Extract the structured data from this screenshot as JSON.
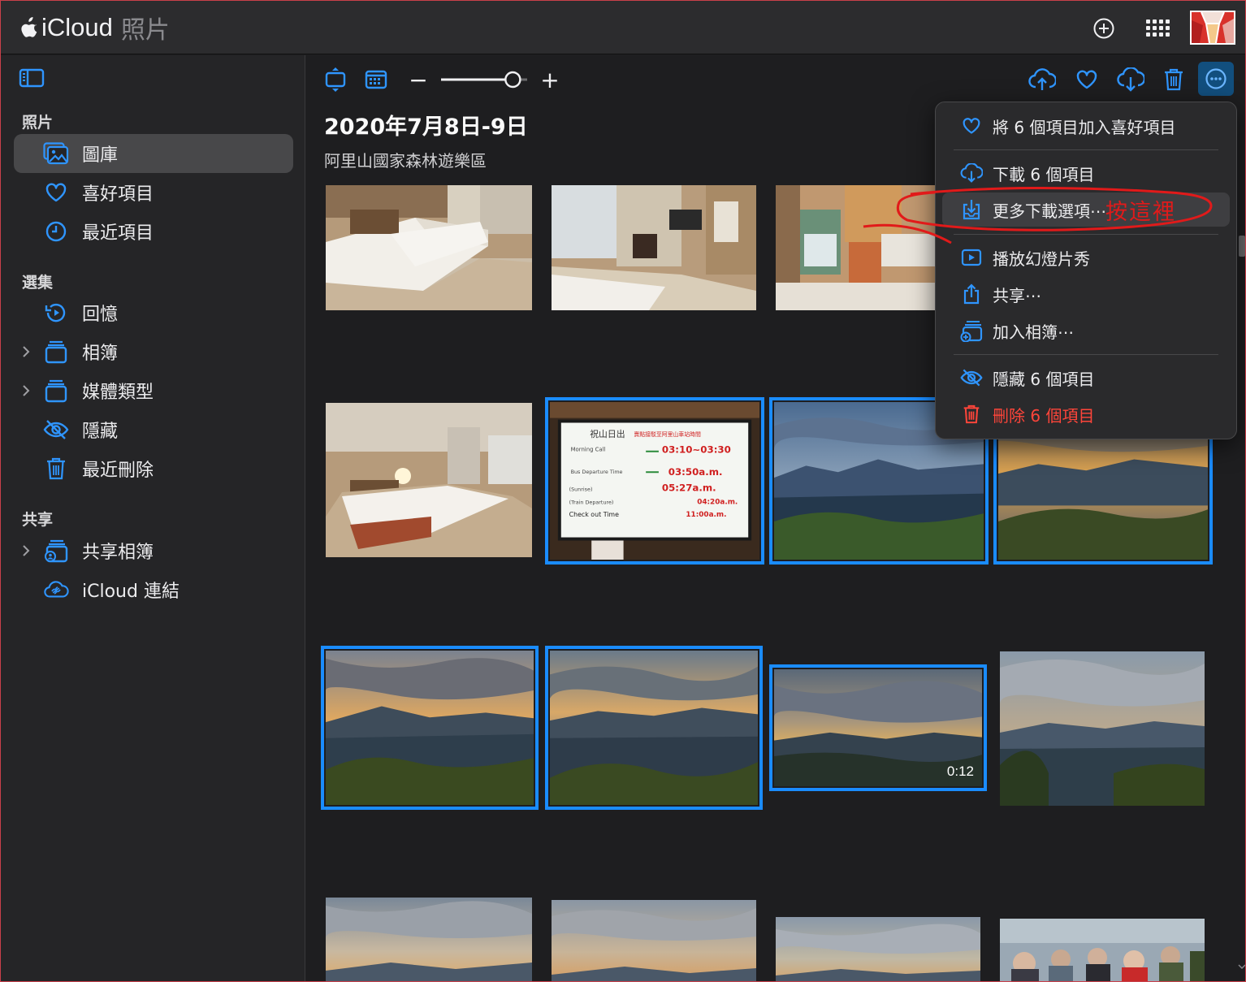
{
  "app": {
    "brand": "iCloud",
    "product": "照片"
  },
  "sidebar": {
    "sections": [
      {
        "title": "照片"
      },
      {
        "title": "選集"
      },
      {
        "title": "共享"
      }
    ],
    "items": [
      {
        "label": "圖庫",
        "icon": "photo-library-icon",
        "active": true
      },
      {
        "label": "喜好項目",
        "icon": "heart-icon"
      },
      {
        "label": "最近項目",
        "icon": "clock-icon"
      },
      {
        "label": "回憶",
        "icon": "memories-icon"
      },
      {
        "label": "相簿",
        "icon": "album-stack-icon",
        "expandable": true
      },
      {
        "label": "媒體類型",
        "icon": "album-stack-icon",
        "expandable": true
      },
      {
        "label": "隱藏",
        "icon": "eye-slash-icon"
      },
      {
        "label": "最近刪除",
        "icon": "trash-icon"
      },
      {
        "label": "共享相簿",
        "icon": "shared-album-icon",
        "expandable": true
      },
      {
        "label": "iCloud 連結",
        "icon": "link-cloud-icon"
      }
    ]
  },
  "toolbar": {
    "zoom_minus": "−",
    "zoom_plus": "+",
    "zoom_level": 0.82
  },
  "content": {
    "date_title": "2020年7月8日-9日",
    "location": "阿里山國家森林遊樂區",
    "video_duration": "0:12"
  },
  "menu": {
    "items": [
      {
        "label": "將 6 個項目加入喜好項目",
        "icon": "heart-icon"
      },
      {
        "label": "下載 6 個項目",
        "icon": "cloud-download-icon"
      },
      {
        "label": "更多下載選項⋯",
        "icon": "download-tray-icon"
      },
      {
        "label": "播放幻燈片秀",
        "icon": "play-icon"
      },
      {
        "label": "共享⋯",
        "icon": "share-icon"
      },
      {
        "label": "加入相簿⋯",
        "icon": "add-album-icon"
      },
      {
        "label": "隱藏 6 個項目",
        "icon": "eye-slash-icon"
      },
      {
        "label": "刪除 6 個項目",
        "icon": "trash-icon"
      }
    ]
  },
  "annotation": {
    "text": "按這裡"
  },
  "colors": {
    "accent": "#1a8cff",
    "icon_blue": "#2f95ff",
    "danger": "#ff453a",
    "annotation_red": "#e11a1a"
  }
}
